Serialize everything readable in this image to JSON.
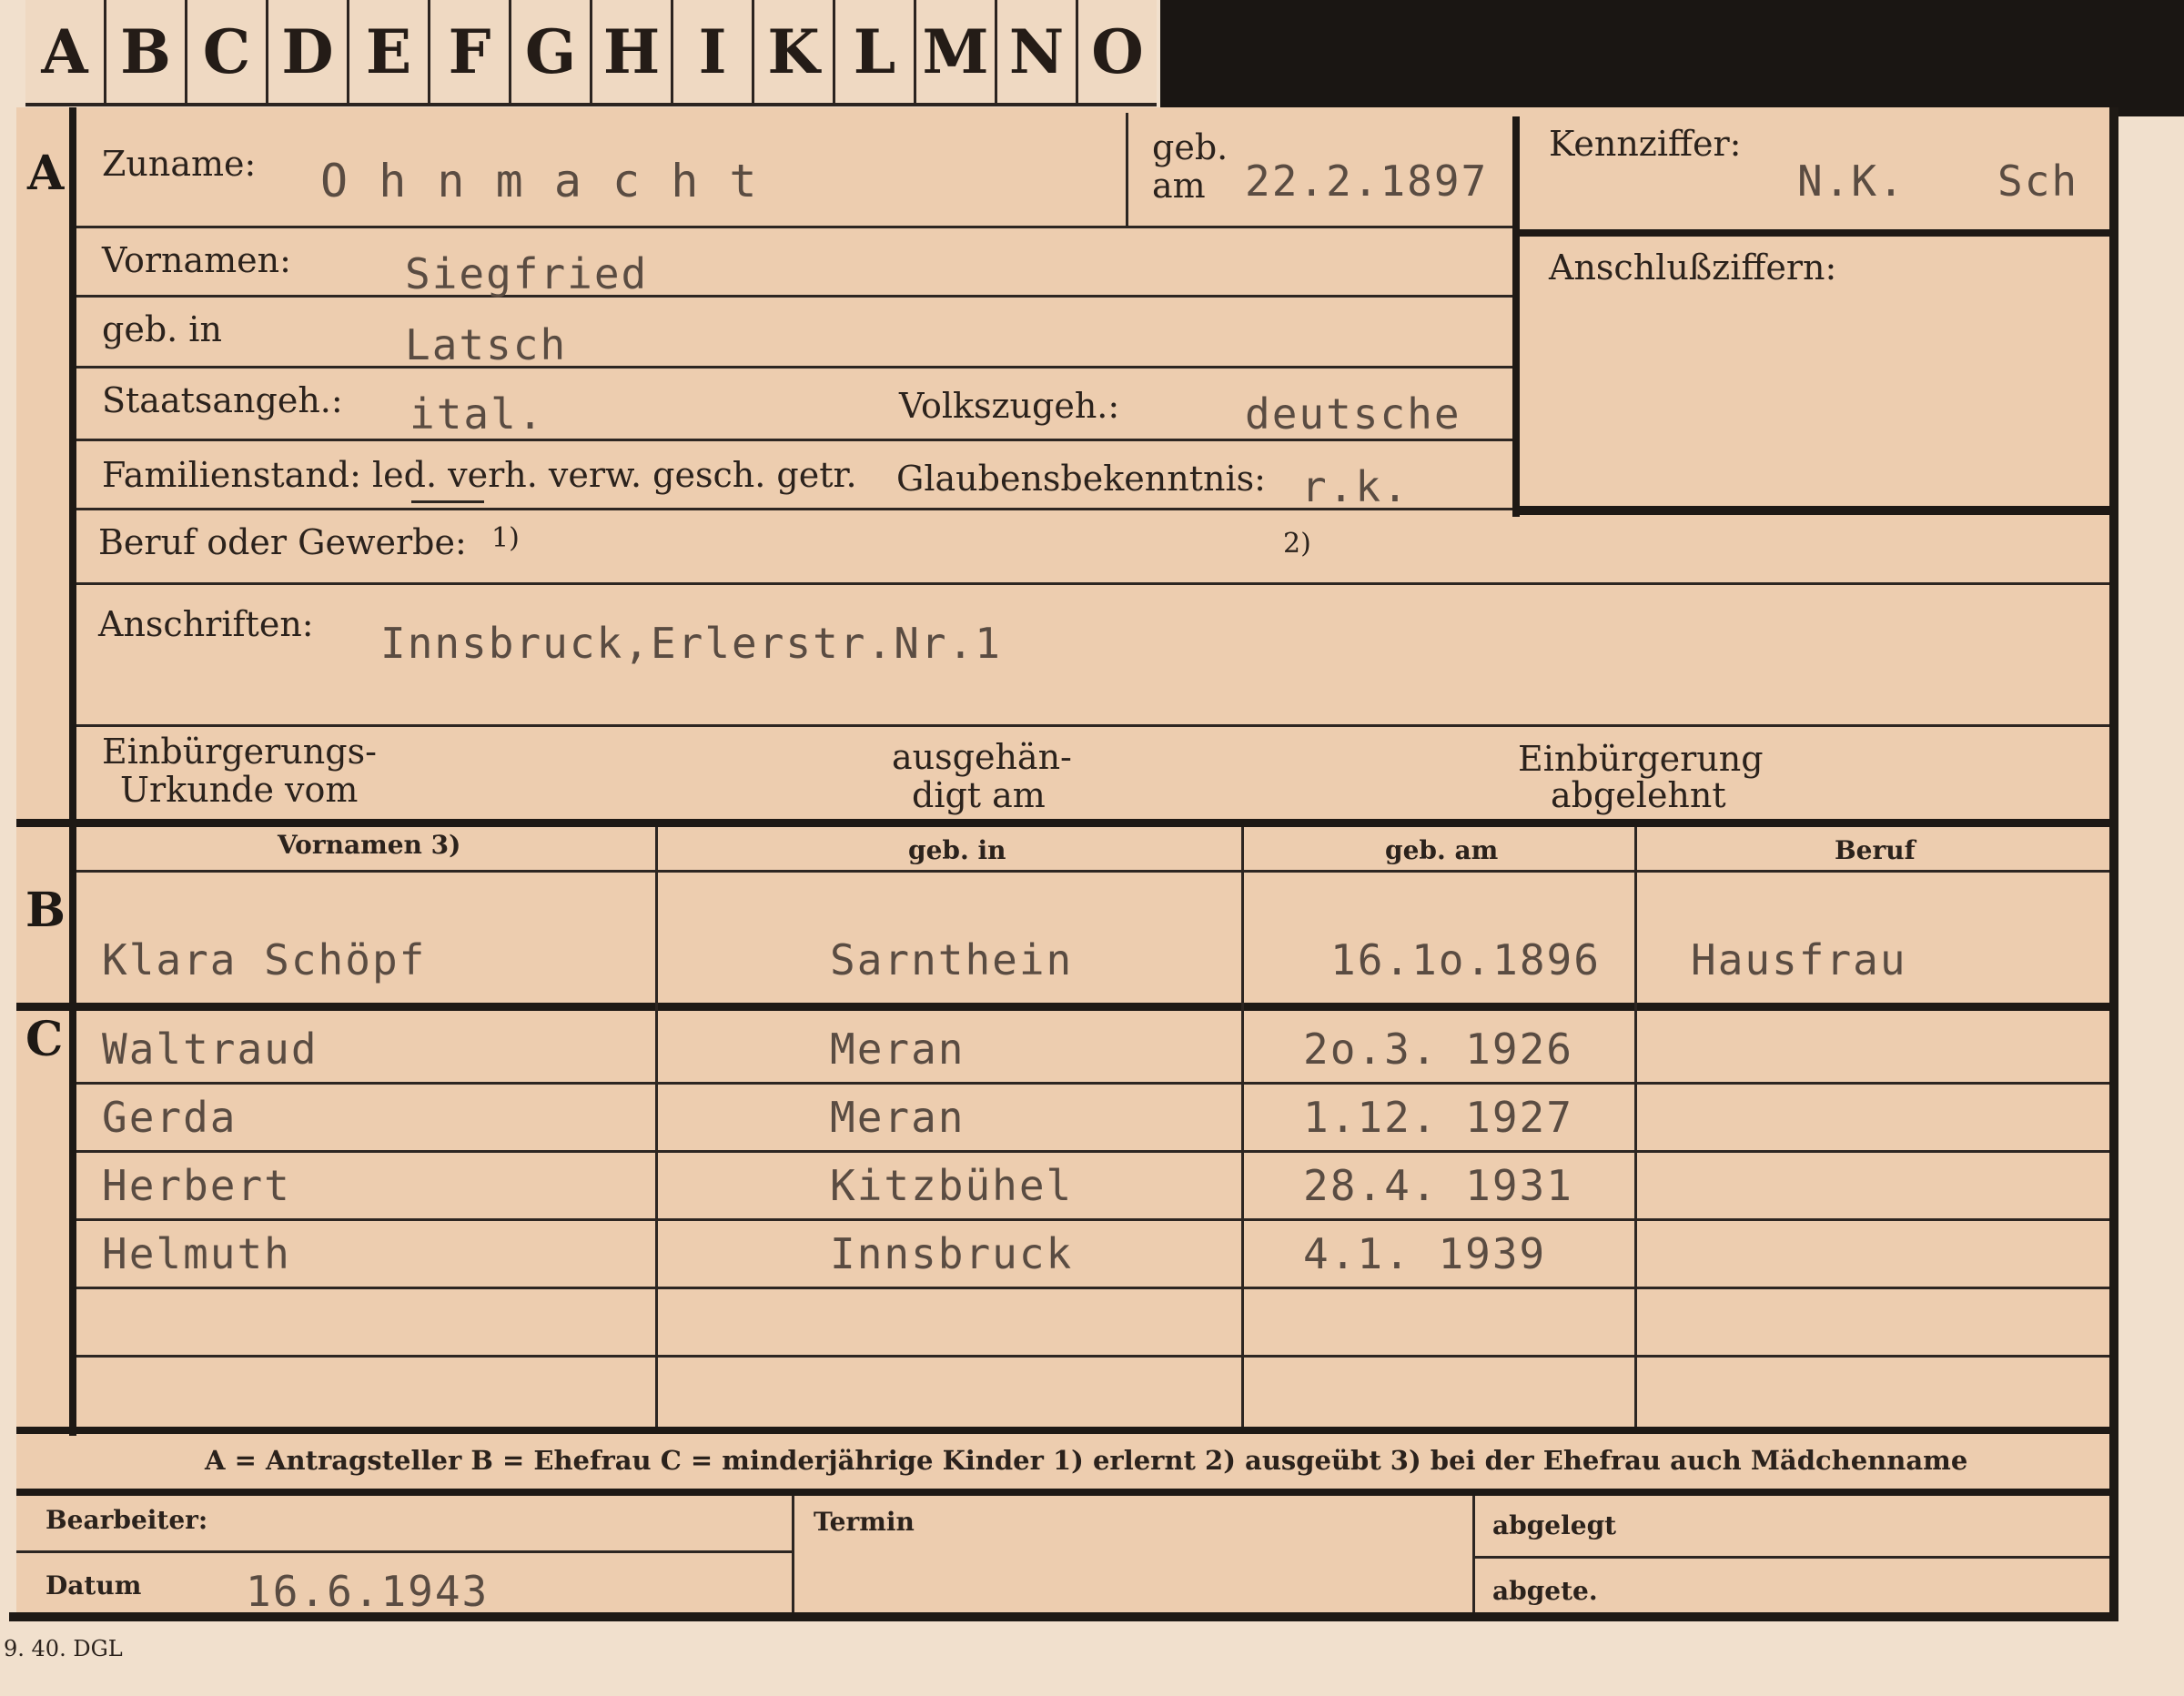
{
  "tabs": [
    "A",
    "B",
    "C",
    "D",
    "E",
    "F",
    "G",
    "H",
    "I",
    "K",
    "L",
    "M",
    "N",
    "O"
  ],
  "section_a": {
    "marker": "A",
    "zuname_label": "Zuname:",
    "zuname": "O h n m a c h t",
    "geb_label": "geb.",
    "am_label": "am",
    "geb_am": "22.2.1897",
    "kennziffer_label": "Kennziffer:",
    "kennziffer": "N.K.",
    "kennziffer_code": "Sch",
    "anschluss_label": "Anschlußziffern:",
    "vornamen_label": "Vornamen:",
    "vornamen": "Siegfried",
    "geb_in_label": "geb. in",
    "geb_in": "Latsch",
    "staats_label": "Staatsangeh.:",
    "staats": "ital.",
    "volks_label": "Volkszugeh.:",
    "volks": "deutsche",
    "familien_label": "Familienstand: led. verh. verw. gesch. getr.",
    "glauben_label": "Glaubensbekenntnis:",
    "glauben": "r.k.",
    "beruf_label": "Beruf oder Gewerbe:",
    "beruf_note1": "1)",
    "beruf_note2": "2)",
    "anschriften_label": "Anschriften:",
    "anschriften": "Innsbruck,Erlerstr.Nr.1",
    "einb_urkunde_l1": "Einbürgerungs-",
    "einb_urkunde_l2": "Urkunde vom",
    "ausgehaend_l1": "ausgehän-",
    "ausgehaend_l2": "digt am",
    "einb_abgelehnt_l1": "Einbürgerung",
    "einb_abgelehnt_l2": "abgelehnt"
  },
  "section_b": {
    "marker": "B",
    "headers": [
      "Vornamen 3)",
      "geb. in",
      "geb. am",
      "Beruf"
    ],
    "row": [
      "Klara Schöpf",
      "Sarnthein",
      "16.1o.1896",
      "Hausfrau"
    ]
  },
  "section_c": {
    "marker": "C",
    "rows": [
      [
        "Waltraud",
        "Meran",
        "2o.3. 1926",
        ""
      ],
      [
        "Gerda",
        "Meran",
        "1.12. 1927",
        ""
      ],
      [
        "Herbert",
        "Kitzbühel",
        "28.4. 1931",
        ""
      ],
      [
        "Helmuth",
        "Innsbruck",
        "4.1. 1939",
        ""
      ],
      [
        "",
        "",
        "",
        ""
      ],
      [
        "",
        "",
        "",
        ""
      ]
    ]
  },
  "legend": "A = Antragsteller   B = Ehefrau   C = minderjährige Kinder   1) erlernt   2) ausgeübt   3) bei der Ehefrau auch Mädchenname",
  "footer": {
    "bearbeiter_label": "Bearbeiter:",
    "datum_label": "Datum",
    "datum": "16.6.1943",
    "termin_label": "Termin",
    "abgelegt_label": "abgelegt",
    "abgeto_label": "abgete."
  },
  "print_code": "9. 40. DGL"
}
